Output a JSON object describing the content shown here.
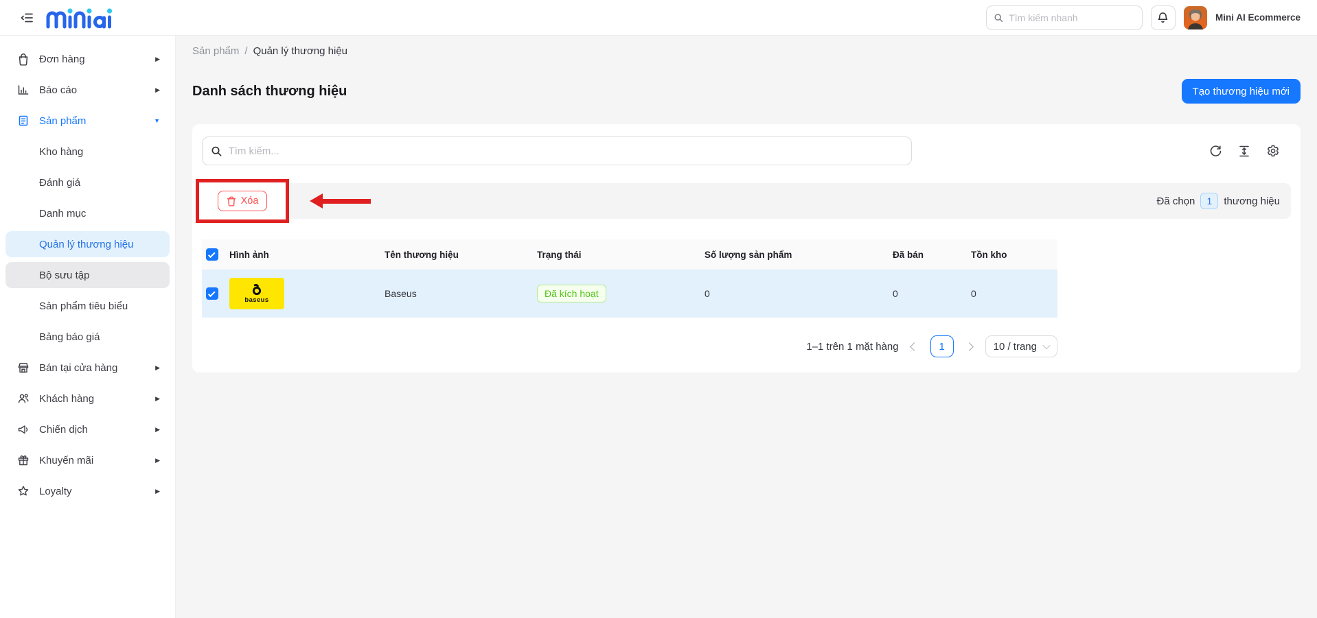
{
  "colors": {
    "accent": "#1677ff",
    "danger": "#ff4d4f",
    "annotation": "#e02020",
    "success": "#52c41a",
    "brand-yellow": "#ffe600"
  },
  "header": {
    "logo_text": "miniai",
    "quick_search_placeholder": "Tìm kiếm nhanh",
    "account_name": "Mini AI Ecommerce"
  },
  "sidebar": {
    "orders": "Đơn hàng",
    "reports": "Báo cáo",
    "products": "Sản phẩm",
    "sub_warehouse": "Kho hàng",
    "sub_reviews": "Đánh giá",
    "sub_categories": "Danh mục",
    "sub_brands": "Quản lý thương hiệu",
    "sub_collections": "Bộ sưu tập",
    "sub_featured": "Sản phẩm tiêu biểu",
    "sub_pricelist": "Bảng báo giá",
    "store_sales": "Bán tại cửa hàng",
    "customers": "Khách hàng",
    "campaigns": "Chiến dịch",
    "promotions": "Khuyến mãi",
    "loyalty": "Loyalty"
  },
  "breadcrumb": {
    "parent": "Sản phẩm",
    "separator": "/",
    "current": "Quản lý thương hiệu"
  },
  "page": {
    "title": "Danh sách thương hiệu",
    "create_button": "Tạo thương hiệu mới"
  },
  "toolbar": {
    "search_placeholder": "Tìm kiếm..."
  },
  "bulk": {
    "delete_label": "Xóa",
    "selected_prefix": "Đã chọn",
    "selected_count": "1",
    "selected_suffix": "thương hiệu"
  },
  "table": {
    "columns": [
      "Hình ảnh",
      "Tên thương hiệu",
      "Trạng thái",
      "Số lượng sản phẩm",
      "Đã bán",
      "Tồn kho"
    ],
    "rows": [
      {
        "logo_word": "baseus",
        "name": "Baseus",
        "status": "Đã kích hoạt",
        "quantity": "0",
        "sold": "0",
        "stock": "0"
      }
    ]
  },
  "pagination": {
    "total_text": "1–1 trên 1 mặt hàng",
    "current_page": "1",
    "page_size": "10 / trang"
  }
}
